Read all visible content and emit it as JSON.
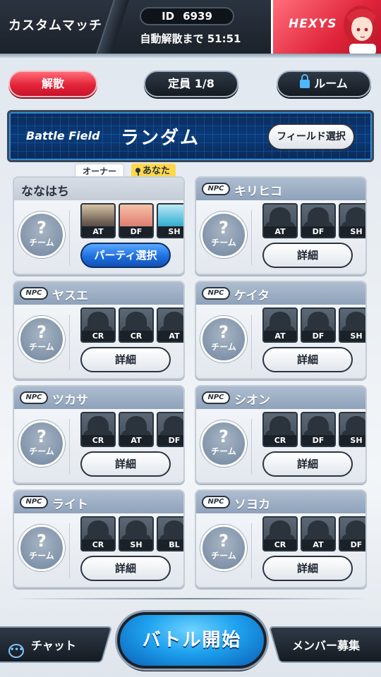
{
  "header": {
    "title": "カスタムマッチ",
    "room_id_label": "ID",
    "room_id": "6939",
    "auto_disband": "自動解散まで 51:51",
    "brand": "HEXYS"
  },
  "top_buttons": {
    "disband": "解散",
    "capacity": "定員 1/8",
    "room": "ルーム"
  },
  "battle_field": {
    "label": "Battle Field",
    "value": "ランダム",
    "select_button": "フィールド選択"
  },
  "owner_tags": {
    "owner": "オーナー",
    "you": "あなた"
  },
  "npc_label": "NPC",
  "team_label": "チーム",
  "team_mark": "?",
  "players": [
    {
      "name": "ななはち",
      "npc": false,
      "slots": [
        "AT",
        "DF",
        "SH"
      ],
      "button": "パーティ選択"
    },
    {
      "name": "キリヒコ",
      "npc": true,
      "slots": [
        "AT",
        "DF",
        "SH"
      ],
      "button": "詳細"
    },
    {
      "name": "ヤスエ",
      "npc": true,
      "slots": [
        "CR",
        "CR",
        "AT"
      ],
      "button": "詳細"
    },
    {
      "name": "ケイタ",
      "npc": true,
      "slots": [
        "AT",
        "DF",
        "SH"
      ],
      "button": "詳細"
    },
    {
      "name": "ツカサ",
      "npc": true,
      "slots": [
        "CR",
        "AT",
        "DF"
      ],
      "button": "詳細"
    },
    {
      "name": "シオン",
      "npc": true,
      "slots": [
        "CR",
        "DF",
        "SH"
      ],
      "button": "詳細"
    },
    {
      "name": "ライト",
      "npc": true,
      "slots": [
        "CR",
        "SH",
        "BL"
      ],
      "button": "詳細"
    },
    {
      "name": "ソヨカ",
      "npc": true,
      "slots": [
        "CR",
        "AT",
        "DF"
      ],
      "button": "詳細"
    }
  ],
  "bottom_bar": {
    "chat": "チャット",
    "start": "バトル開始",
    "recruit": "メンバー募集"
  },
  "colors": {
    "accent_red": "#e3243a",
    "accent_blue": "#1ea2ef",
    "dark": "#1b2129"
  }
}
